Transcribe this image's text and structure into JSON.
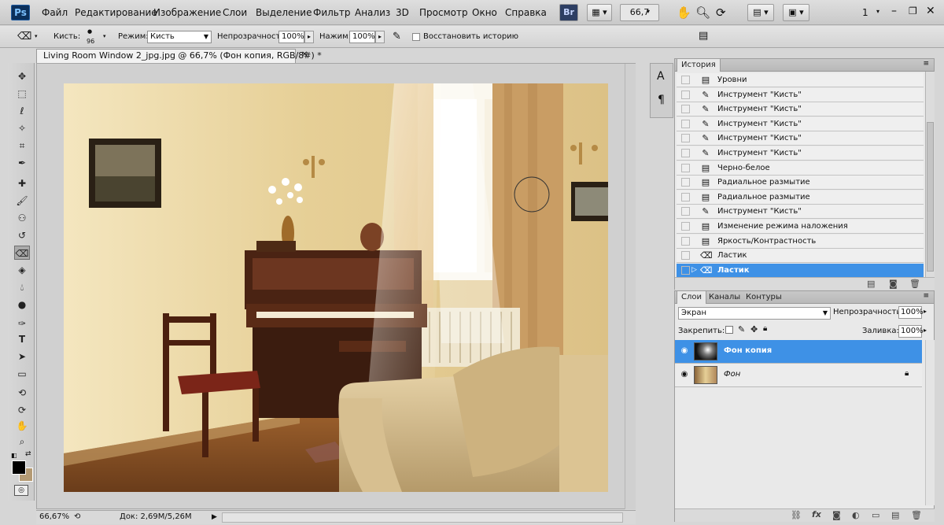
{
  "menubar": {
    "logo": "Ps",
    "items": [
      "Файл",
      "Редактирование",
      "Изображение",
      "Слои",
      "Выделение",
      "Фильтр",
      "Анализ",
      "3D",
      "Просмотр",
      "Окно",
      "Справка"
    ],
    "bridge": "Br",
    "zoom": "66,7",
    "workspace": "1"
  },
  "options": {
    "brush_label": "Кисть:",
    "brush_size": "96",
    "mode_label": "Режим:",
    "mode_value": "Кисть",
    "opacity_label": "Непрозрачность:",
    "opacity_value": "100%",
    "flow_label": "Нажим:",
    "flow_value": "100%",
    "history_label": "Восстановить историю"
  },
  "document": {
    "tab_title": "Living Room Window 2_jpg.jpg @ 66,7% (Фон копия, RGB/8#) *",
    "status_zoom": "66,67%",
    "status_doc": "Док: 2,69M/5,26M"
  },
  "history": {
    "tab": "История",
    "items": [
      {
        "icon": "doc-icon",
        "label": "Уровни"
      },
      {
        "icon": "brush-icon",
        "label": "Инструмент \"Кисть\""
      },
      {
        "icon": "brush-icon",
        "label": "Инструмент \"Кисть\""
      },
      {
        "icon": "brush-icon",
        "label": "Инструмент \"Кисть\""
      },
      {
        "icon": "brush-icon",
        "label": "Инструмент \"Кисть\""
      },
      {
        "icon": "brush-icon",
        "label": "Инструмент \"Кисть\""
      },
      {
        "icon": "doc-icon",
        "label": "Черно-белое"
      },
      {
        "icon": "doc-icon",
        "label": "Радиальное размытие"
      },
      {
        "icon": "doc-icon",
        "label": "Радиальное размытие"
      },
      {
        "icon": "brush-icon",
        "label": "Инструмент \"Кисть\""
      },
      {
        "icon": "doc-icon",
        "label": "Изменение режима наложения"
      },
      {
        "icon": "doc-icon",
        "label": "Яркость/Контрастность"
      },
      {
        "icon": "eraser-icon",
        "label": "Ластик"
      },
      {
        "icon": "eraser-icon",
        "label": "Ластик"
      }
    ]
  },
  "layers": {
    "tabs": [
      "Слои",
      "Каналы",
      "Контуры"
    ],
    "blend_mode": "Экран",
    "opacity_label": "Непрозрачность:",
    "opacity_value": "100%",
    "lock_label": "Закрепить:",
    "fill_label": "Заливка:",
    "fill_value": "100%",
    "items": [
      {
        "name": "Фон копия",
        "selected": true
      },
      {
        "name": "Фон",
        "selected": false
      }
    ]
  },
  "colors": {
    "accent": "#3e91e6",
    "foreground": "#000000",
    "background": "#b49a74"
  }
}
